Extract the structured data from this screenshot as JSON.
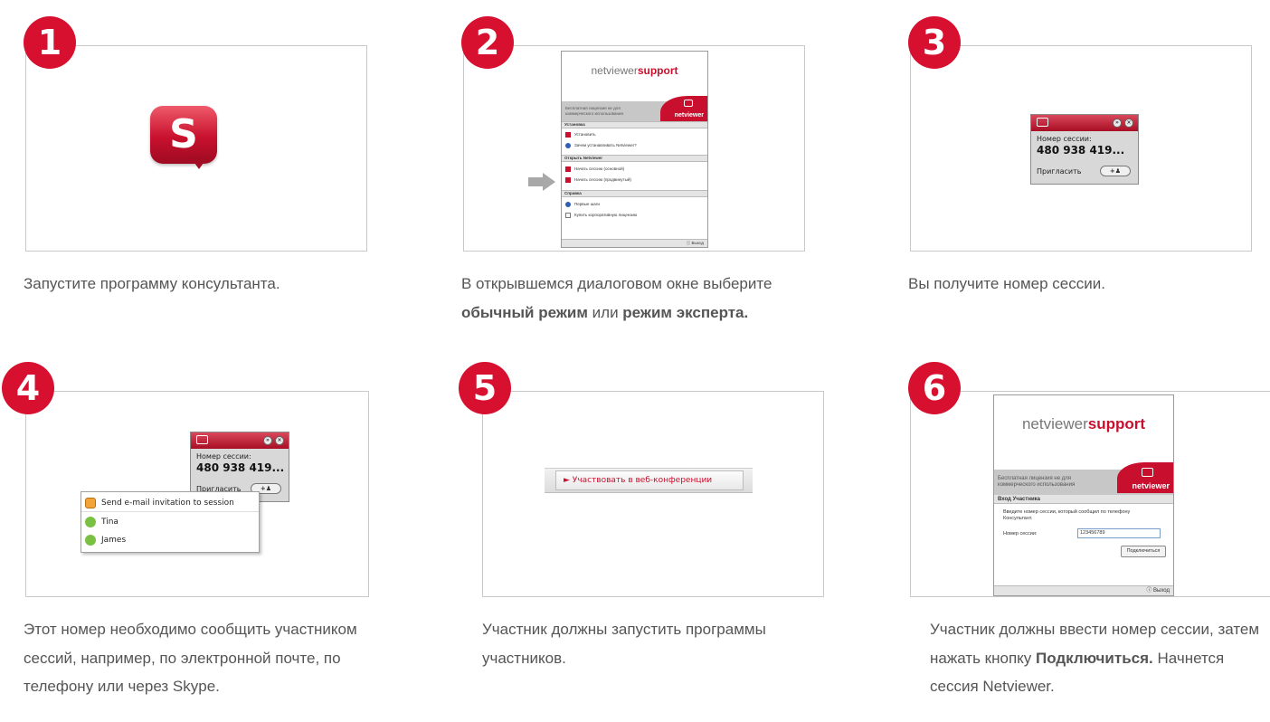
{
  "steps": [
    {
      "num": "1",
      "caption": "Запустите программу консультанта."
    },
    {
      "num": "2",
      "caption_parts": [
        "В открывшемся диалоговом окне выберите ",
        "обычный режим",
        " или ",
        "режим эксперта."
      ]
    },
    {
      "num": "3",
      "caption": "Вы получите номер сессии."
    },
    {
      "num": "4",
      "caption": "Этот номер необходимо сообщить участником сессий, например, по электронной почте, по телефону или через Skype."
    },
    {
      "num": "5",
      "caption": "Участник должны запустить программы участников."
    },
    {
      "num": "6",
      "caption_parts": [
        "Участник должны ввести номер сессии, затем нажать кнопку ",
        "Подключиться.",
        " Начнется сессия Netviewer."
      ]
    }
  ],
  "colors": {
    "accent": "#d7102f",
    "text": "#555555",
    "frame_border": "#c9c9c9"
  },
  "icons": {
    "step1": "S"
  },
  "netviewer": {
    "logo_a": "netviewer",
    "logo_b": "support",
    "band_text": "Бесплатная лицензия не для коммерческого использования",
    "brand": "netviewer",
    "section_install": "Установка",
    "item_install": "Установить",
    "item_why": "Зачем устанавливать Netviewer?",
    "section_open": "Открыть Netviewer",
    "item_start_basic": "Начать сессию (основной)",
    "item_start_adv": "Начать сессию (продвинутый)",
    "section_help": "Справка",
    "item_first": "Первые шаги",
    "item_buy": "Купить корпоративную лицензию",
    "exit": "ⓘ Выход"
  },
  "session": {
    "label": "Номер сессии:",
    "number": "480 938 419...",
    "invite": "Пригласить",
    "add": "+♟",
    "btn_fwd": "»",
    "btn_close": "×"
  },
  "popup": {
    "email": "Send e-mail invitation to session",
    "contact1": "Tina",
    "contact2": "James"
  },
  "join": {
    "label": "► Участвовать в веб-конференции"
  },
  "participant": {
    "section": "Вход Участника",
    "desc": "Введите номер сессии, который сообщил по телефону Консультант.",
    "field_label": "Номер сессии:",
    "field_value": "123456789",
    "connect": "Подключиться"
  }
}
